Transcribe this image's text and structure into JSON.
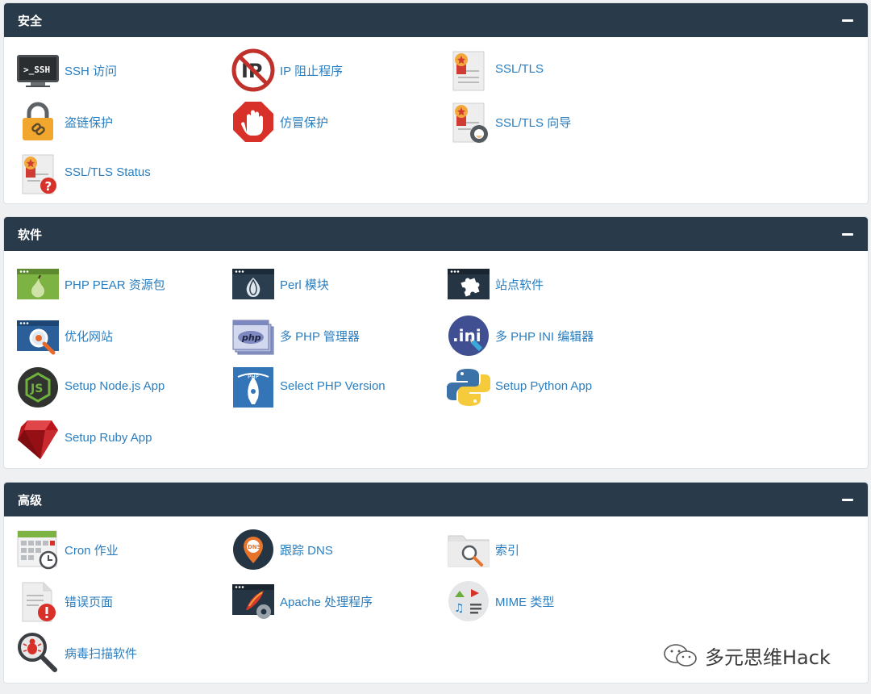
{
  "sections": [
    {
      "title": "安全",
      "items": [
        {
          "label": "SSH 访问",
          "icon": "ssh-terminal-icon"
        },
        {
          "label": "IP 阻止程序",
          "icon": "ip-blocker-icon"
        },
        {
          "label": "SSL/TLS",
          "icon": "ssl-certificate-icon"
        },
        {
          "label": "盗链保护",
          "icon": "padlock-link-icon"
        },
        {
          "label": "仿冒保护",
          "icon": "stop-hand-icon"
        },
        {
          "label": "SSL/TLS 向导",
          "icon": "ssl-wizard-icon"
        },
        {
          "label": "SSL/TLS Status",
          "icon": "ssl-status-icon"
        }
      ]
    },
    {
      "title": "软件",
      "items": [
        {
          "label": "PHP PEAR 资源包",
          "icon": "php-pear-icon"
        },
        {
          "label": "Perl 模块",
          "icon": "perl-onion-icon"
        },
        {
          "label": "站点软件",
          "icon": "puzzle-piece-icon"
        },
        {
          "label": "优化网站",
          "icon": "optimize-website-icon"
        },
        {
          "label": "多 PHP 管理器",
          "icon": "multiphp-manager-icon"
        },
        {
          "label": "多 PHP INI 编辑器",
          "icon": "ini-editor-icon"
        },
        {
          "label": "Setup Node.js App",
          "icon": "nodejs-icon"
        },
        {
          "label": "Select PHP Version",
          "icon": "select-php-version-icon"
        },
        {
          "label": "Setup Python App",
          "icon": "python-icon"
        },
        {
          "label": "Setup Ruby App",
          "icon": "ruby-gem-icon"
        }
      ]
    },
    {
      "title": "高级",
      "items": [
        {
          "label": "Cron 作业",
          "icon": "cron-calendar-icon"
        },
        {
          "label": "跟踪 DNS",
          "icon": "dns-pin-icon"
        },
        {
          "label": "索引",
          "icon": "folder-search-icon"
        },
        {
          "label": "错误页面",
          "icon": "error-page-icon"
        },
        {
          "label": "Apache 处理程序",
          "icon": "apache-feather-icon"
        },
        {
          "label": "MIME 类型",
          "icon": "mime-types-icon"
        },
        {
          "label": "病毒扫描软件",
          "icon": "virus-scan-icon"
        }
      ]
    }
  ],
  "watermark": "多元思维Hack",
  "colors": {
    "header_bg": "#293a4a",
    "link": "#2a7ec0",
    "page_bg": "#eef0f2"
  }
}
